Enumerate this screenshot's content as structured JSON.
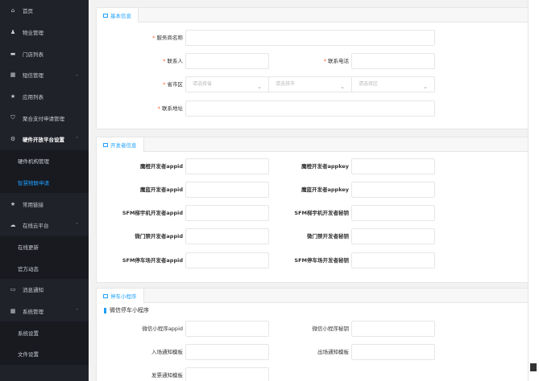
{
  "sidebar": {
    "items": [
      {
        "label": "首页",
        "icon": "home"
      },
      {
        "label": "物业管理",
        "icon": "users"
      },
      {
        "label": "门店列表",
        "icon": "card"
      },
      {
        "label": "短信管理",
        "icon": "grid"
      },
      {
        "label": "应用列表",
        "icon": "star"
      },
      {
        "label": "聚合支付申请管理",
        "icon": "shield"
      },
      {
        "label": "硬件开放平台设置",
        "icon": "gear"
      },
      {
        "label": "硬件机构管理",
        "sub": true
      },
      {
        "label": "智慧物联申请",
        "sub": true
      },
      {
        "label": "常用链接",
        "icon": "star"
      },
      {
        "label": "在线云平台",
        "icon": "cloud"
      },
      {
        "label": "在线更新",
        "sub": true
      },
      {
        "label": "官方动态",
        "sub": true
      },
      {
        "label": "消息通知",
        "icon": "chat"
      },
      {
        "label": "系统管理",
        "icon": "grid"
      },
      {
        "label": "系统设置",
        "sub": true
      },
      {
        "label": "文件设置",
        "sub": true
      }
    ]
  },
  "basic": {
    "tab": "基本信息",
    "service_name_label": "服务商名称",
    "contact_label": "联系人",
    "phone_label": "联系电话",
    "region_label": "省市区",
    "province_placeholder": "请选择省",
    "city_placeholder": "请选择市",
    "district_placeholder": "请选择区",
    "address_label": "联系地址",
    "required_mark": "*"
  },
  "developer": {
    "tab": "开发者信息",
    "f1": "魔橙开发者appid",
    "f2": "魔橙开发者appkey",
    "f3": "魔蓝开发者appid",
    "f4": "魔蓝开发者appkey",
    "f5": "SFM梯宇机开发者appid",
    "f6": "SFM梯宇机开发者秘钥",
    "f7": "微门禁开发者appid",
    "f8": "微门禁开发者秘钥",
    "f9": "SFM停车场开发者appid",
    "f10": "SFM停车场开发者秘钥"
  },
  "parking": {
    "tab": "停车小程序",
    "section": "微信停车小程序",
    "f1": "微信小程序appid",
    "f2": "微信小程序秘钥",
    "f3": "入场通知模板",
    "f4": "出场通知模板",
    "f5": "发票通知模板"
  }
}
